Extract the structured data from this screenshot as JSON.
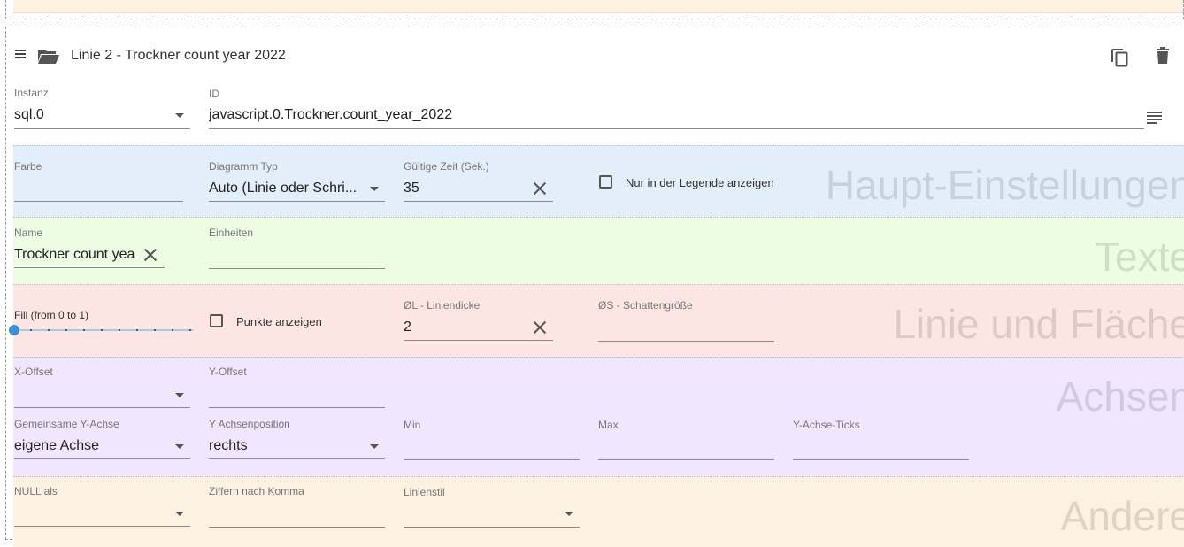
{
  "line": {
    "title": "Linie 2 - Trockner count year 2022",
    "instance_label": "Instanz",
    "instance_value": "sql.0",
    "id_label": "ID",
    "id_value": "javascript.0.Trockner.count_year_2022"
  },
  "main_settings": {
    "watermark": "Haupt-Einstellungen",
    "color_label": "Farbe",
    "color_value": "",
    "chart_type_label": "Diagramm Typ",
    "chart_type_value": "Auto (Linie oder Schri...",
    "valid_time_label": "Gültige Zeit (Sek.)",
    "valid_time_value": "35",
    "legend_only_label": "Nur in der Legende anzeigen",
    "legend_only_checked": false
  },
  "texts": {
    "watermark": "Texte",
    "name_label": "Name",
    "name_value": "Trockner count yea",
    "units_label": "Einheiten",
    "units_value": ""
  },
  "line_area": {
    "watermark": "Linie und Fläche",
    "fill_label": "Fill (from 0 to 1)",
    "fill_value": 0,
    "points_label": "Punkte anzeigen",
    "points_checked": false,
    "line_width_label": "ØL - Liniendicke",
    "line_width_value": "2",
    "shadow_label": "ØS - Schattengröße",
    "shadow_value": ""
  },
  "axes": {
    "watermark": "Achsen",
    "x_offset_label": "X-Offset",
    "x_offset_value": "",
    "y_offset_label": "Y-Offset",
    "y_offset_value": "",
    "common_y_label": "Gemeinsame Y-Achse",
    "common_y_value": "eigene Achse",
    "y_position_label": "Y Achsenposition",
    "y_position_value": "rechts",
    "min_label": "Min",
    "min_value": "",
    "max_label": "Max",
    "max_value": "",
    "ticks_label": "Y-Achse-Ticks",
    "ticks_value": ""
  },
  "other": {
    "watermark": "Andere",
    "null_as_label": "NULL als",
    "null_as_value": "",
    "digits_label": "Ziffern nach Komma",
    "digits_value": "",
    "line_style_label": "Linienstil",
    "line_style_value": ""
  },
  "colors": {
    "main_bg": "#e3eefb",
    "texts_bg": "#ecfde4",
    "line_bg": "#fde5e3",
    "axes_bg": "#f1e6fd",
    "other_bg": "#fdf1e2",
    "slider_accent": "#3b8fd6"
  }
}
